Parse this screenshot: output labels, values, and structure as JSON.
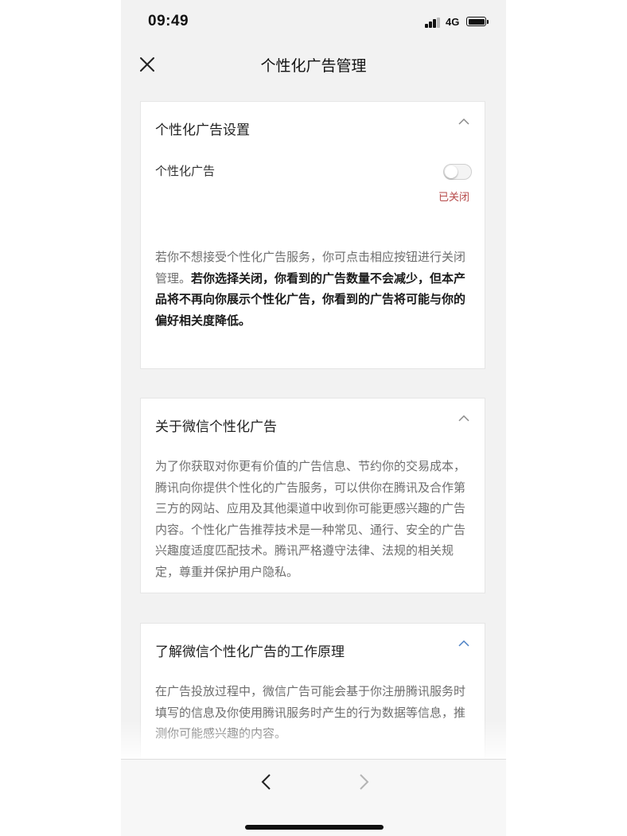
{
  "status_bar": {
    "time": "09:49",
    "network": "4G"
  },
  "nav": {
    "title": "个性化广告管理",
    "close_icon": "close-icon"
  },
  "cards": [
    {
      "title": "个性化广告设置",
      "setting_label": "个性化广告",
      "toggle_status": "已关闭",
      "toggle_on": false,
      "text_normal": "若你不想接受个性化广告服务，你可点击相应按钮进行关闭管理。",
      "text_bold": "若你选择关闭，你看到的广告数量不会减少，但本产品将不再向你展示个性化广告，你看到的广告将可能与你的偏好相关度降低。"
    },
    {
      "title": "关于微信个性化广告",
      "text": "为了你获取对你更有价值的广告信息、节约你的交易成本，腾讯向你提供个性化的广告服务，可以供你在腾讯及合作第三方的网站、应用及其他渠道中收到你可能更感兴趣的广告内容。个性化广告推荐技术是一种常见、通行、安全的广告兴趣度适度匹配技术。腾讯严格遵守法律、法规的相关规定，尊重并保护用户隐私。"
    },
    {
      "title": "了解微信个性化广告的工作原理",
      "text": "在广告投放过程中，微信广告可能会基于你注册腾讯服务时填写的信息及你使用腾讯服务时产生的行为数据等信息，推测你可能感兴趣的内容。"
    }
  ],
  "colors": {
    "status_off": "#b64a4a",
    "card_bg": "#ffffff",
    "page_bg": "#f2f2f2"
  }
}
